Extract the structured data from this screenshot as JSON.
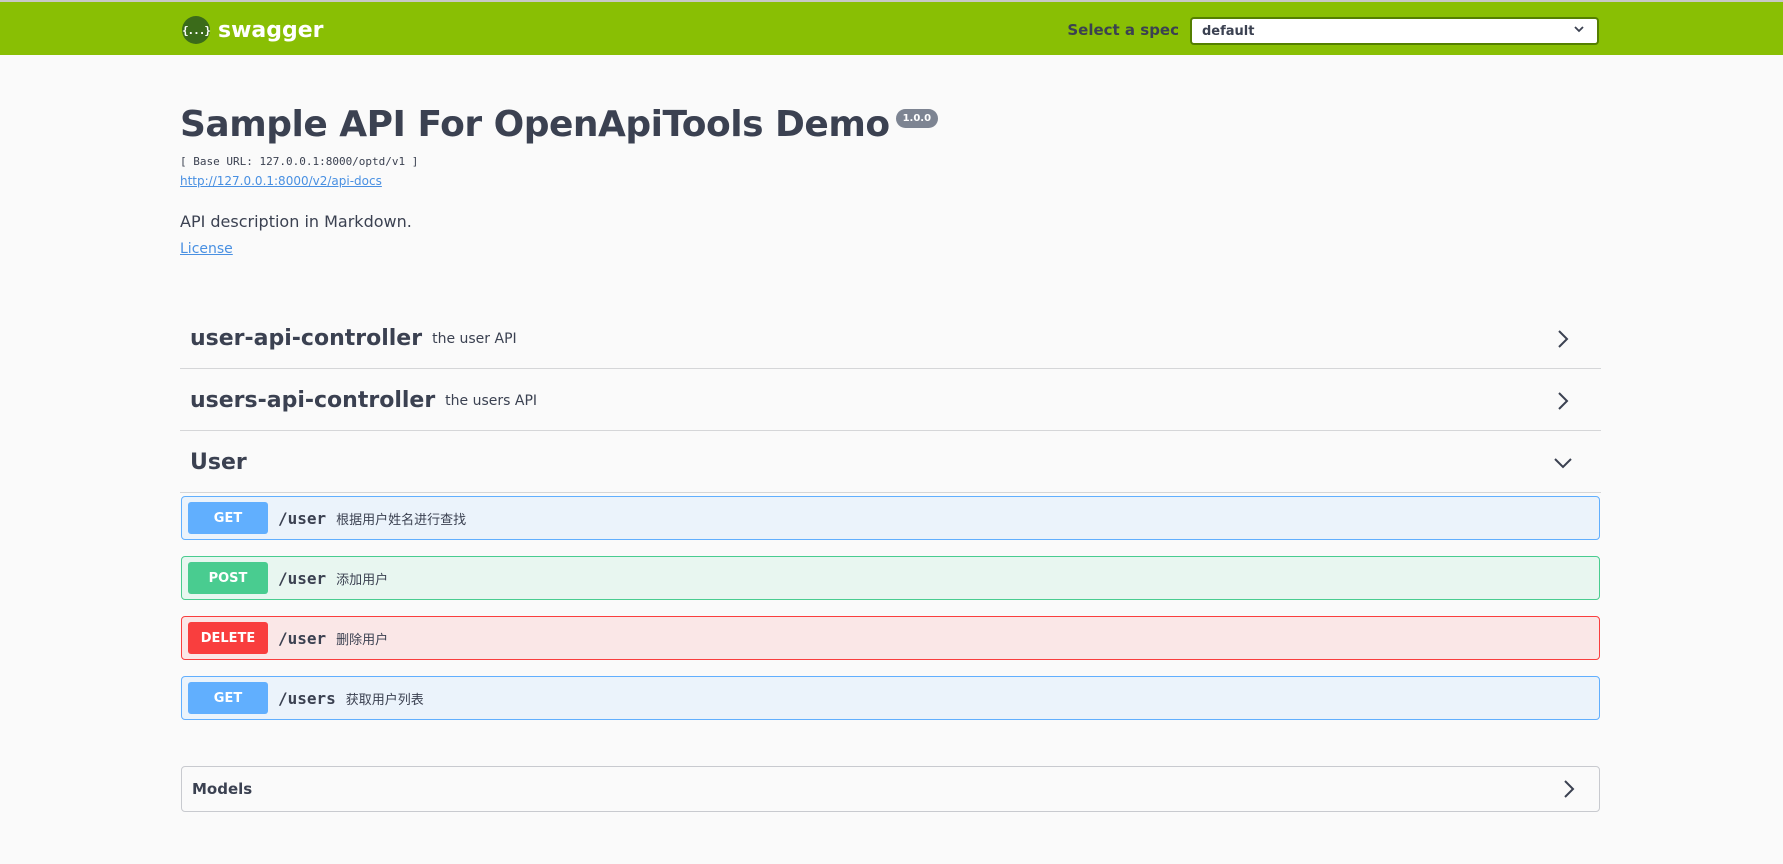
{
  "header": {
    "logo_text": "swagger",
    "logo_icon": "{...}",
    "spec_label": "Select a spec",
    "spec_value": "default"
  },
  "info": {
    "title": "Sample API For OpenApiTools Demo",
    "version": "1.0.0",
    "base_url": "[ Base URL: 127.0.0.1:8000/optd/v1 ]",
    "docs_url": "http://127.0.0.1:8000/v2/api-docs",
    "description": "API description in Markdown.",
    "license": "License"
  },
  "tags": [
    {
      "name": "user-api-controller",
      "description": "the user API",
      "expanded": false
    },
    {
      "name": "users-api-controller",
      "description": "the users API",
      "expanded": false
    },
    {
      "name": "User",
      "description": "",
      "expanded": true
    }
  ],
  "operations": [
    {
      "method": "GET",
      "path": "/user",
      "summary": "根据用户姓名进行查找"
    },
    {
      "method": "POST",
      "path": "/user",
      "summary": "添加用户"
    },
    {
      "method": "DELETE",
      "path": "/user",
      "summary": "删除用户"
    },
    {
      "method": "GET",
      "path": "/users",
      "summary": "获取用户列表"
    }
  ],
  "models": {
    "title": "Models"
  },
  "colors": {
    "topbar": "#89bf04",
    "get": "#61affe",
    "post": "#49cc90",
    "delete": "#f93e3e"
  }
}
